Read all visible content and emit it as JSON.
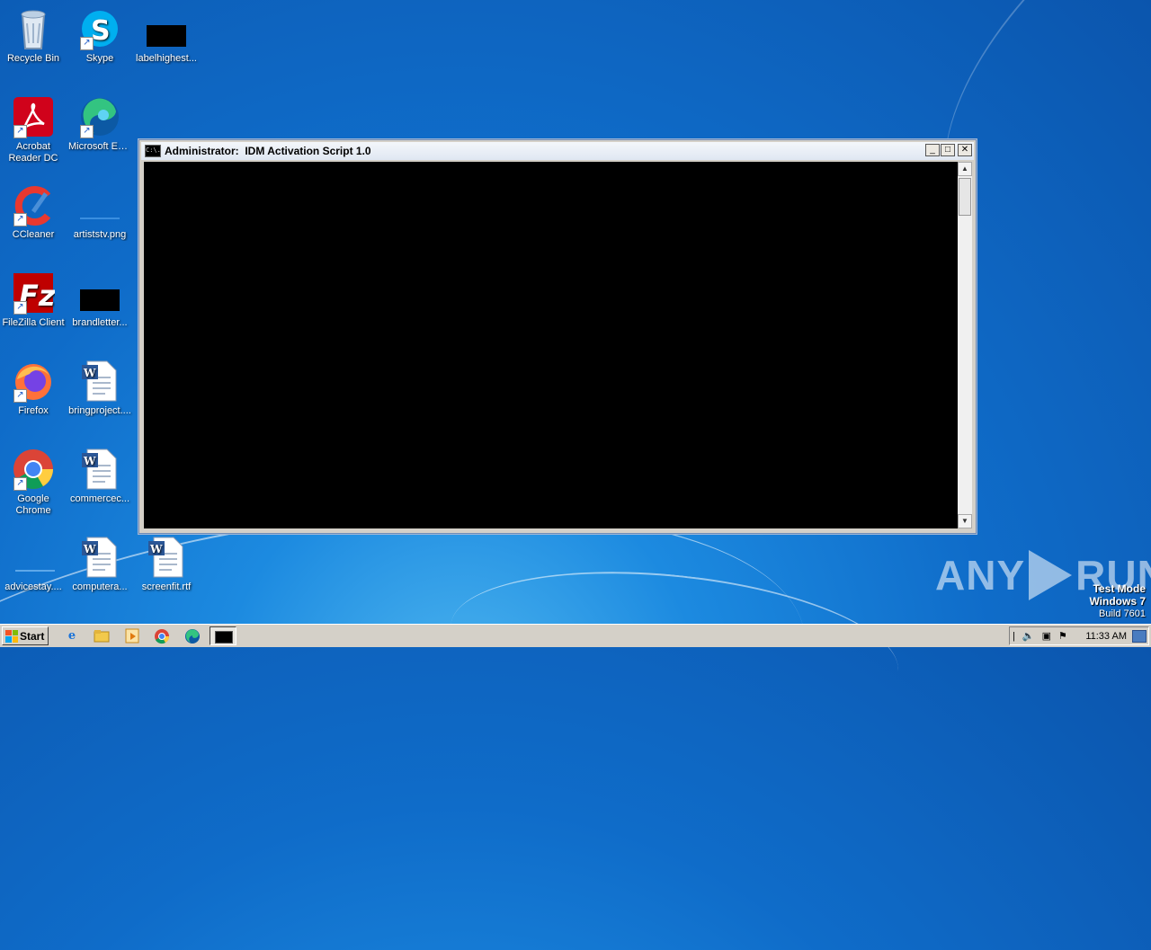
{
  "desktop": {
    "icons": [
      {
        "label": "Recycle Bin"
      },
      {
        "label": "Skype"
      },
      {
        "label": "labelhighest..."
      },
      {
        "label": "Acrobat Reader DC"
      },
      {
        "label": "Microsoft Edge"
      },
      {
        "label": "CCleaner"
      },
      {
        "label": "artiststv.png"
      },
      {
        "label": "FileZilla Client"
      },
      {
        "label": "brandletter..."
      },
      {
        "label": "Firefox"
      },
      {
        "label": "bringproject...."
      },
      {
        "label": "Google Chrome"
      },
      {
        "label": "commercec..."
      },
      {
        "label": "advicestay...."
      },
      {
        "label": "computera..."
      },
      {
        "label": "screenfit.rtf"
      }
    ]
  },
  "console_window": {
    "title": "Administrator:  IDM Activation Script 1.0",
    "icon_text": "C:\\.",
    "minimize": "_",
    "maximize": "□",
    "close": "✕"
  },
  "watermark": {
    "left": "ANY",
    "right": "RUN"
  },
  "test_mode": {
    "line1": "Test Mode",
    "line2": "Windows 7",
    "line3": "Build 7601"
  },
  "taskbar": {
    "start_label": "Start",
    "clock": "11:33 AM",
    "tray_icons": [
      "speaker-icon",
      "network-icon",
      "flag-icon"
    ]
  }
}
